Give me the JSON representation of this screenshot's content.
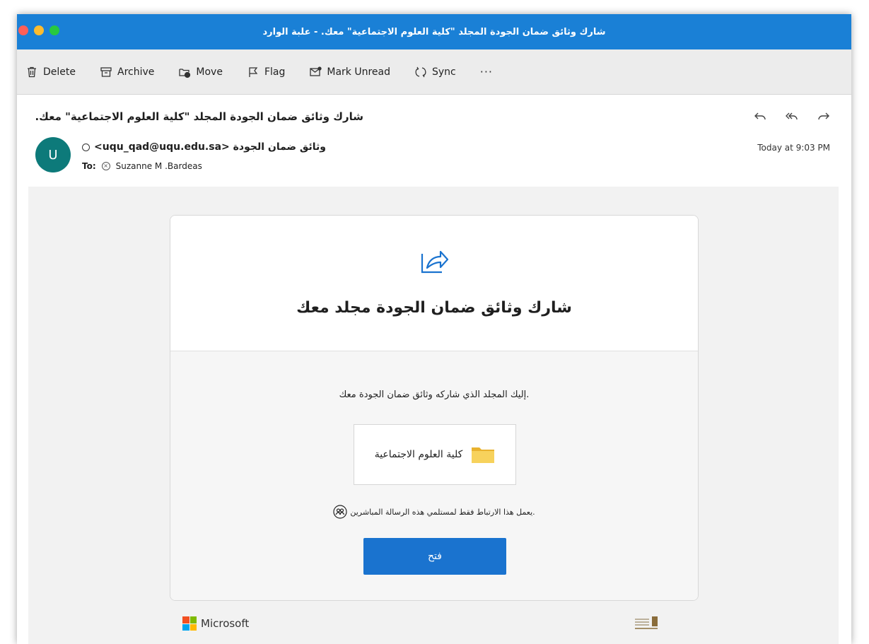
{
  "window": {
    "title": "شارك وثائق ضمان الجودة المجلد \"كلية العلوم الاجتماعية\" معك. - علبة الوارد",
    "traffic_colors": [
      "#ff5f57",
      "#febc2e",
      "#28c840"
    ]
  },
  "toolbar": {
    "items": [
      {
        "label": "Delete",
        "icon": "trash-icon"
      },
      {
        "label": "Archive",
        "icon": "archive-icon"
      },
      {
        "label": "Move",
        "icon": "move-folder-icon"
      },
      {
        "label": "Flag",
        "icon": "flag-icon"
      },
      {
        "label": "Mark Unread",
        "icon": "envelope-icon"
      },
      {
        "label": "Sync",
        "icon": "sync-icon"
      }
    ],
    "more": "···"
  },
  "message": {
    "subject": "شارك وثائق ضمان الجودة المجلد \"كلية العلوم الاجتماعية\" معك.",
    "avatar_initial": "U",
    "avatar_color": "#0d7a7a",
    "sender": "وثائق ضمان الجودة <uqu_qad@uqu.edu.sa>",
    "to_label": "To:",
    "recipient": "Suzanne M .Bardeas",
    "date": "Today at 9:03 PM"
  },
  "card": {
    "heading": "شارك وثائق ضمان الجودة مجلد معك",
    "intro": ".إليك المجلد الذي شاركه وثائق ضمان الجودة معك",
    "folder_name": "كلية العلوم الاجتماعية",
    "note": ".يعمل هذا الارتباط فقط لمستلمي هذه الرسالة المباشرين",
    "open_button": "فتح",
    "accent_color": "#1a73cf"
  },
  "footer": {
    "brand": "Microsoft"
  }
}
